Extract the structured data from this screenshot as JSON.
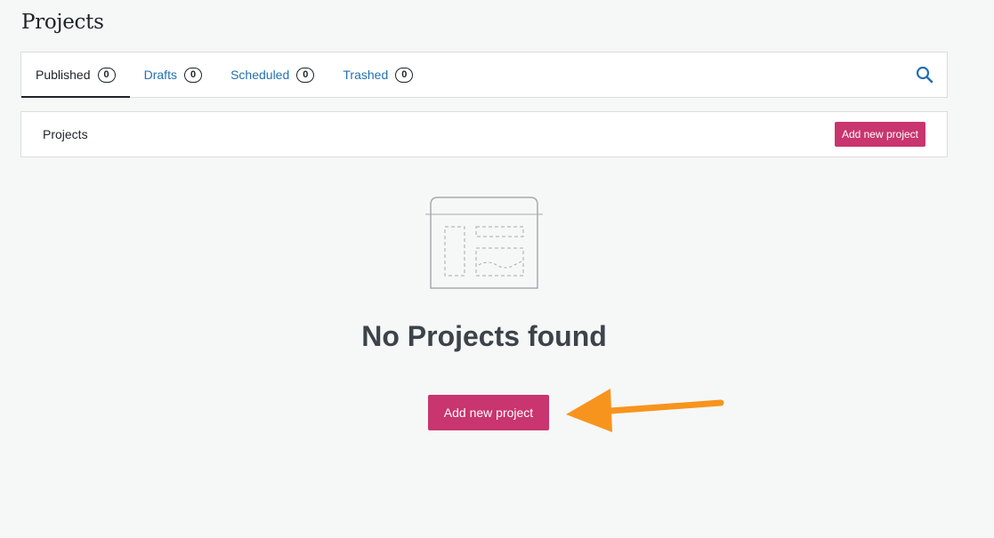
{
  "page": {
    "title": "Projects"
  },
  "tabs": [
    {
      "label": "Published",
      "count": "0",
      "active": true
    },
    {
      "label": "Drafts",
      "count": "0",
      "active": false
    },
    {
      "label": "Scheduled",
      "count": "0",
      "active": false
    },
    {
      "label": "Trashed",
      "count": "0",
      "active": false
    }
  ],
  "search": {
    "icon": "search-icon"
  },
  "list_header": {
    "label": "Projects",
    "add_button_label": "Add new project"
  },
  "empty_state": {
    "illustration": "empty-document-illustration",
    "title": "No Projects found",
    "cta_label": "Add new project"
  },
  "annotation": {
    "arrow_color": "#f7941d"
  },
  "colors": {
    "accent": "#c9356e",
    "link": "#2271b1",
    "background": "#f6f7f7"
  }
}
